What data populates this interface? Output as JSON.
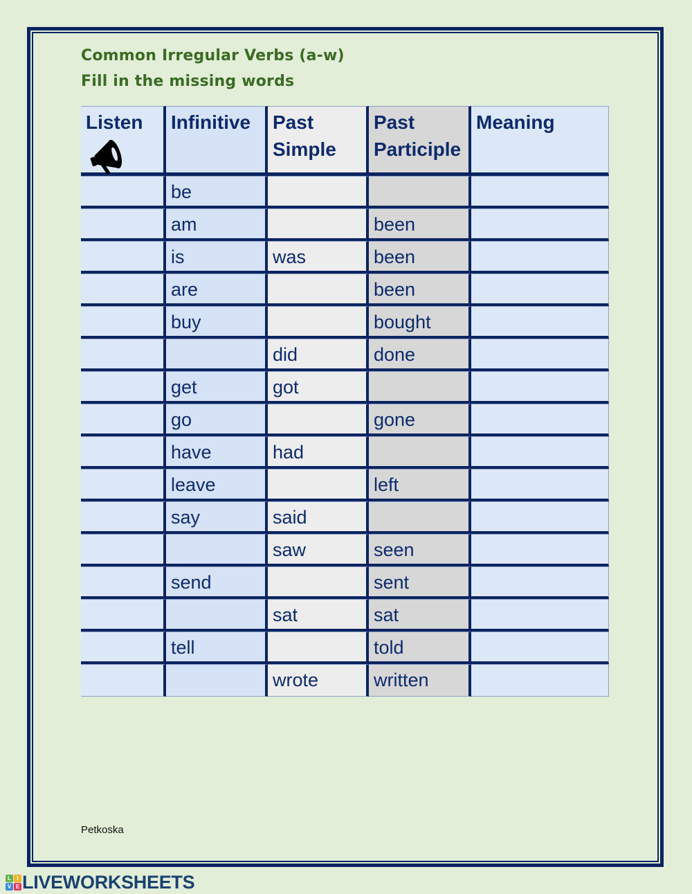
{
  "worksheet": {
    "title_line1": "Common Irregular Verbs (a-w)",
    "title_line2": "Fill in the missing words",
    "author": "Petkoska"
  },
  "table": {
    "headers": {
      "listen": "Listen",
      "infinitive": "Infinitive",
      "past_simple_line1": "Past",
      "past_simple_line2": "Simple",
      "past_participle_line1": "Past",
      "past_participle_line2": "Participle",
      "meaning": "Meaning"
    },
    "listen_icon": "megaphone-icon",
    "rows": [
      {
        "infinitive": "be",
        "past_simple": "",
        "past_participle": "",
        "meaning": ""
      },
      {
        "infinitive": "am",
        "past_simple": "",
        "past_participle": "been",
        "meaning": ""
      },
      {
        "infinitive": "is",
        "past_simple": "was",
        "past_participle": "been",
        "meaning": ""
      },
      {
        "infinitive": "are",
        "past_simple": "",
        "past_participle": "been",
        "meaning": ""
      },
      {
        "infinitive": "buy",
        "past_simple": "",
        "past_participle": "bought",
        "meaning": ""
      },
      {
        "infinitive": "",
        "past_simple": "did",
        "past_participle": "done",
        "meaning": ""
      },
      {
        "infinitive": "get",
        "past_simple": "got",
        "past_participle": "",
        "meaning": ""
      },
      {
        "infinitive": "go",
        "past_simple": "",
        "past_participle": "gone",
        "meaning": ""
      },
      {
        "infinitive": "have",
        "past_simple": "had",
        "past_participle": "",
        "meaning": ""
      },
      {
        "infinitive": "leave",
        "past_simple": "",
        "past_participle": "left",
        "meaning": ""
      },
      {
        "infinitive": "say",
        "past_simple": "said",
        "past_participle": "",
        "meaning": ""
      },
      {
        "infinitive": "",
        "past_simple": "saw",
        "past_participle": "seen",
        "meaning": ""
      },
      {
        "infinitive": "send",
        "past_simple": "",
        "past_participle": "sent",
        "meaning": ""
      },
      {
        "infinitive": "",
        "past_simple": "sat",
        "past_participle": "sat",
        "meaning": ""
      },
      {
        "infinitive": "tell",
        "past_simple": "",
        "past_participle": "told",
        "meaning": ""
      },
      {
        "infinitive": "",
        "past_simple": "wrote",
        "past_participle": "written",
        "meaning": ""
      }
    ]
  },
  "brand": {
    "name": "LIVEWORKSHEETS",
    "logo_letters": [
      "L",
      "I",
      "V",
      "E"
    ],
    "logo_colors": [
      "#6ab04c",
      "#f0b429",
      "#3d8bd9",
      "#e8365d"
    ]
  },
  "colors": {
    "page_background": "#e2eed8",
    "frame_navy": "#0b2460",
    "title_green": "#3b6b23",
    "text_navy": "#0d2a6b"
  }
}
